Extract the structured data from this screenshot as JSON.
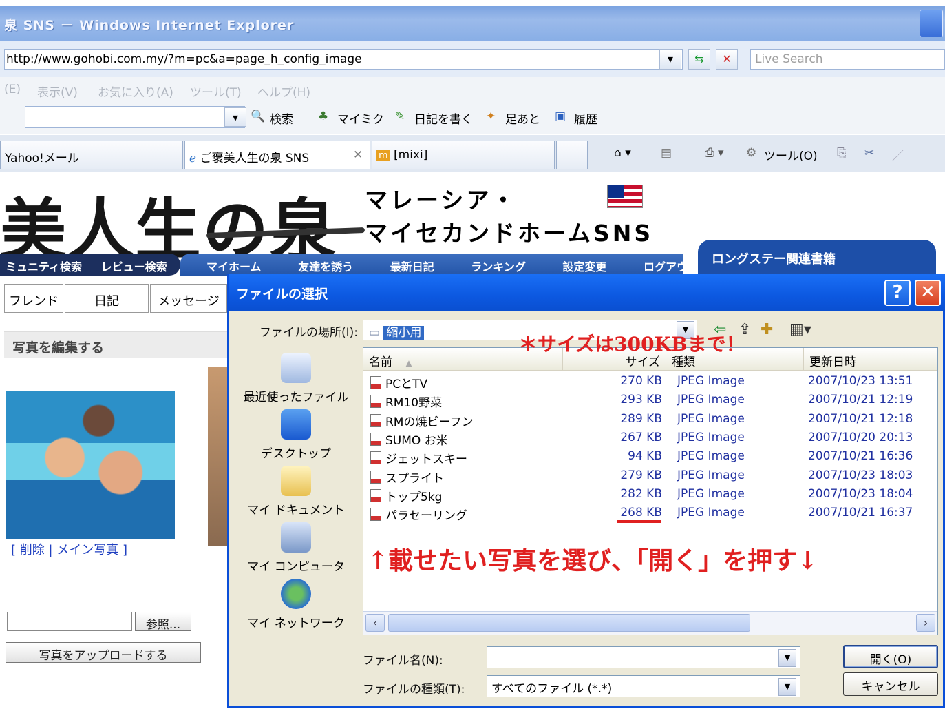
{
  "window": {
    "title": "泉 SNS － Windows Internet Explorer"
  },
  "address": {
    "url": "http://www.gohobi.com.my/?m=pc&a=page_h_config_image",
    "search_placeholder": "Live Search"
  },
  "menu": [
    "(E)",
    "表示(V)",
    "お気に入り(A)",
    "ツール(T)",
    "ヘルプ(H)"
  ],
  "toolbar": {
    "search_label": "検索",
    "mixi_label": "マイミク",
    "diary_label": "日記を書く",
    "footprint_label": "足あと",
    "history_label": "履歴"
  },
  "tabs": [
    {
      "label": "Yahoo!メール"
    },
    {
      "label": "ご褒美人生の泉 SNS"
    },
    {
      "label": "[mixi]"
    }
  ],
  "tools_label": "ツール(O)",
  "page": {
    "logo_text": "美人生の泉",
    "header_line1": "マレーシア・",
    "header_line2": "マイセカンドホームSNS",
    "nav_dark": [
      "ミュニティ検索",
      "レビュー検索"
    ],
    "nav_blue": [
      "マイホーム",
      "友達を誘う",
      "最新日記",
      "ランキング",
      "設定変更",
      "ログアウト"
    ],
    "longstay_label": "ロングステー関連書籍",
    "subtabs": [
      "フレンド",
      "日記",
      "メッセージ"
    ],
    "section_title": "写真を編集する",
    "delete_link": "削除",
    "main_photo_link": "メイン写真",
    "browse_button": "参照...",
    "upload_button": "写真をアップロードする"
  },
  "dialog": {
    "title": "ファイルの選択",
    "lookin_label": "ファイルの場所(I):",
    "lookin_value": "縮小用",
    "places": [
      "最近使ったファイル",
      "デスクトップ",
      "マイ ドキュメント",
      "マイ コンピュータ",
      "マイ ネットワーク"
    ],
    "columns": {
      "name": "名前",
      "size": "サイズ",
      "type": "種類",
      "date": "更新日時"
    },
    "files": [
      {
        "name": "PCとTV",
        "size": "270 KB",
        "type": "JPEG Image",
        "date": "2007/10/23 13:51"
      },
      {
        "name": "RM10野菜",
        "size": "293 KB",
        "type": "JPEG Image",
        "date": "2007/10/21 12:19"
      },
      {
        "name": "RMの焼ビーフン",
        "size": "289 KB",
        "type": "JPEG Image",
        "date": "2007/10/21 12:18"
      },
      {
        "name": "SUMO お米",
        "size": "267 KB",
        "type": "JPEG Image",
        "date": "2007/10/20 20:13"
      },
      {
        "name": "ジェットスキー",
        "size": "94 KB",
        "type": "JPEG Image",
        "date": "2007/10/21 16:36"
      },
      {
        "name": "スプライト",
        "size": "279 KB",
        "type": "JPEG Image",
        "date": "2007/10/23 18:03"
      },
      {
        "name": "トップ5kg",
        "size": "282 KB",
        "type": "JPEG Image",
        "date": "2007/10/23 18:04"
      },
      {
        "name": "パラセーリング",
        "size": "268 KB",
        "type": "JPEG Image",
        "date": "2007/10/21 16:37"
      }
    ],
    "annotation_size": "＊サイズは300KBまで！",
    "annotation_instruction": "↑載せたい写真を選び、「開く」を押す↓",
    "filename_label": "ファイル名(N):",
    "filename_value": "",
    "filetype_label": "ファイルの種類(T):",
    "filetype_value": "すべてのファイル (*.*)",
    "open_button": "開く(O)",
    "cancel_button": "キャンセル"
  },
  "colors": {
    "xp_blue": "#0a4fd8",
    "annotation_red": "#e02020",
    "nav_navy": "#1c2f5e"
  }
}
